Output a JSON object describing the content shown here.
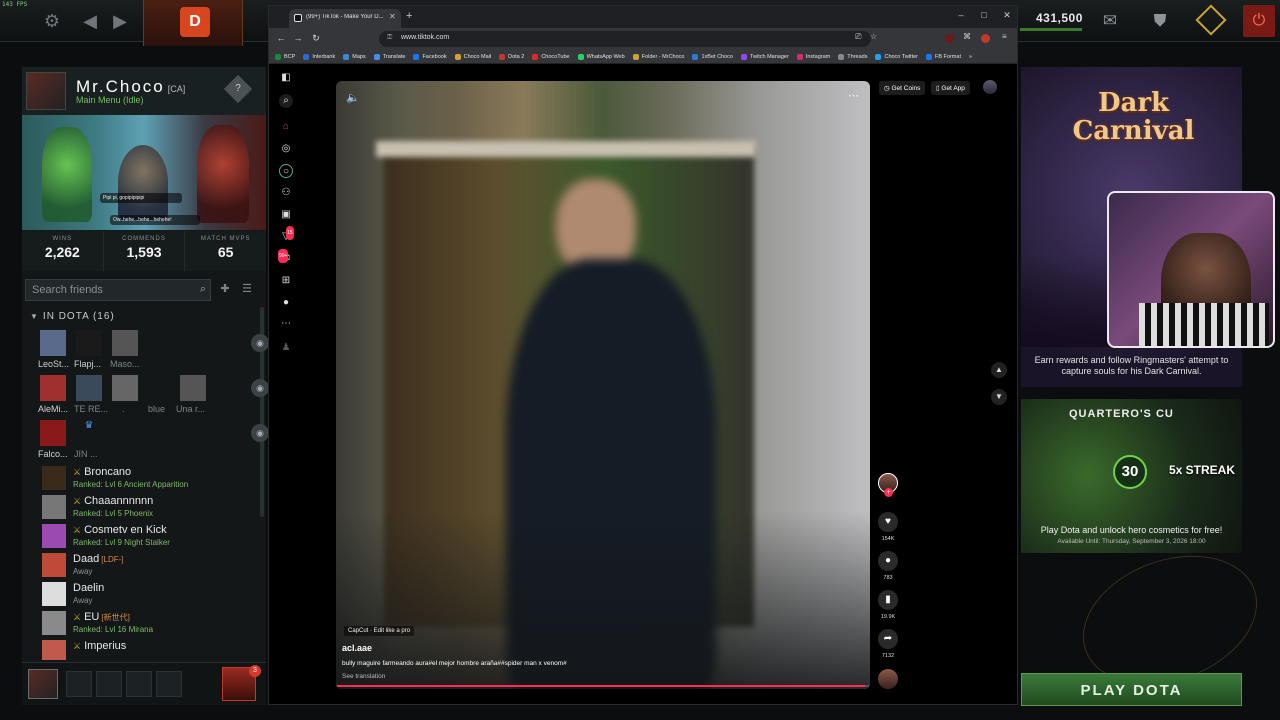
{
  "topbar": {
    "fps": "143 FPS",
    "shards": "431,500"
  },
  "profile": {
    "name": "Mr.Choco",
    "tag": "[CA]",
    "status": "Main Menu (Idle)",
    "chat_1": "Pipi pi, gopipipipipi",
    "chat_2": "Ow..hehe...hehe...hehehe!",
    "stats": [
      {
        "label": "WINS",
        "value": "2,262"
      },
      {
        "label": "COMMENDS",
        "value": "1,593"
      },
      {
        "label": "MATCH MVPS",
        "value": "65"
      }
    ]
  },
  "friends": {
    "search_placeholder": "Search friends",
    "in_dota_header": "IN DOTA (16)",
    "party_rows": [
      [
        "LeoSt...",
        "Flapj...",
        "Maso..."
      ],
      [
        "AleMi...",
        "TE RE...",
        ".",
        "blue",
        "Una r..."
      ],
      [
        "Falco...",
        "JIN ..."
      ]
    ],
    "list": [
      {
        "name": "Broncano",
        "tag": "",
        "sub": "Ranked: Lvl 6 Ancient Apparition",
        "away": false
      },
      {
        "name": "Chaaannnnnn",
        "tag": "",
        "sub": "Ranked: Lvl 5 Phoenix",
        "away": false
      },
      {
        "name": "Cosmetv en Kick",
        "tag": "",
        "sub": "Ranked: Lvl 9 Night Stalker",
        "away": false
      },
      {
        "name": "Daad",
        "tag": "[LDF-]",
        "sub": "Away",
        "away": true
      },
      {
        "name": "Daelin",
        "tag": "",
        "sub": "Away",
        "away": true
      },
      {
        "name": "EU",
        "tag": "[新世代]",
        "sub": "Ranked: Lvl 16 Mirana",
        "away": false
      },
      {
        "name": "Imperius",
        "tag": "",
        "sub": "",
        "away": false
      }
    ],
    "notification_count": "3"
  },
  "browser": {
    "tab_title": "(99+) TikTok - Make Your D...",
    "url": "www.tiktok.com",
    "bookmarks": [
      "BCP",
      "Interbank",
      "Maps",
      "Translate",
      "Facebook",
      "Choco Mail",
      "Dota 2",
      "ChocoTube",
      "WhatsApp Web",
      "Folder - MrChoco",
      "1xBet Choco",
      "Twitch Manager",
      "Instagram",
      "Threads",
      "Choco Twitter",
      "FB Format"
    ]
  },
  "tiktok": {
    "get_coins": "Get Coins",
    "get_app": "Get App",
    "inbox_badge": "99+",
    "activity_badge": "15",
    "capcut": "CapCut · Edit like a pro",
    "author": "acl.aae",
    "description": "bully maguire farmeando aura#el mejor hombre araña##spider man x venom#",
    "see_translation": "See translation",
    "likes": "154K",
    "comments": "783",
    "saves": "19.9K",
    "shares": "7132",
    "progress_fraction": 0.99
  },
  "promo": {
    "carnival_title": "Dark Carnival",
    "carnival_desc": "Earn rewards and follow Ringmasters' attempt to capture souls for his Dark Carnival.",
    "quartero_title": "QUARTERO'S CU",
    "streak_num": "30",
    "streak_label": "5x STREAK",
    "quartero_desc": "Play Dota and unlock hero cosmetics for free!",
    "quartero_avail": "Available Until:  Thursday, September 3, 2026 18:00",
    "play_button": "PLAY DOTA"
  },
  "colors": {
    "accent_red": "#fe2c55",
    "status_green": "#6ec15a",
    "play_green": "#3a7a3a"
  }
}
